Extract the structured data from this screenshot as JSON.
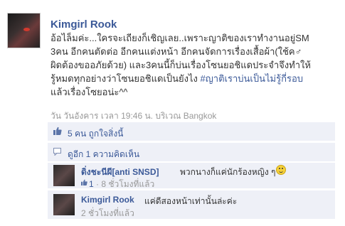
{
  "post": {
    "author": "Kimgirl Rook",
    "message_lines": [
      "อ้อไล็มค่ะ...ใครจะเถียงก็เชิญเลย..เพราะญาติของเราทำงานอยู่SM",
      "3คน อีกคนตัดต่อ อีกคนแต่งหน้า อีกคนจัดการเรื่องเสื้อผ้า(ใช้ค♂",
      "ผิดต้องขออภัยด้วย) และ3คนนี้ก็บ่นเรื่องโซนยอชิแดประจำจึงทำให้",
      "รู้หมดทุกอย่างว่าโซนยอชิแดเป็นยังไง",
      "แล้วเรื่องโซยอน่ะ^^"
    ],
    "hashtag": "#ญาติเราบ่นเป็นไม่รู้กี่รอบ",
    "meta": "วัน วันอังคาร เวลา 19:46 น. บริเวณ Bangkok"
  },
  "likes": {
    "text": "5 คน ถูกใจสิ่งนี้"
  },
  "more_comments": {
    "text": "ดูอีก 1 ความคิดเห็น"
  },
  "comments": [
    {
      "author": "ดิ่งชะนีผี[anti SNSD]",
      "body": "พวกนางก็แค่นักร้องหญิง ๆ",
      "like_count": "1",
      "time": "· 8 ชั่วโมงที่แล้ว"
    },
    {
      "author": "Kimgirl Rook",
      "body": "แค่ดีสองหน้าเท่านั้นล่ะค่ะ",
      "time": "2 ชั่วโมงที่แล้ว"
    }
  ],
  "icons": {
    "like": "thumbs-up-icon",
    "comment": "speech-bubble-icon",
    "emoticon": "smile-emoticon-icon"
  },
  "colors": {
    "link": "#3b5998",
    "ufi_bg": "#eef0f7",
    "meta": "#999999"
  }
}
